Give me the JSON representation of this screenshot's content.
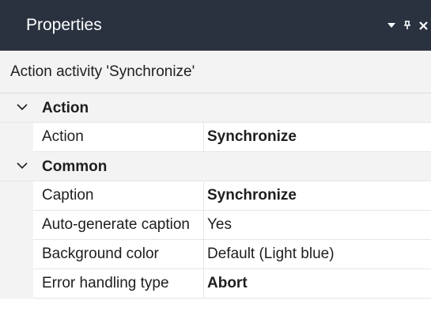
{
  "panel": {
    "title": "Properties",
    "colors": {
      "titlebar": "#2a3240",
      "title_text": "#ffffff",
      "category_bg": "#f3f3f3"
    },
    "buttons": {
      "dropdown_icon": "caret-down-icon",
      "pin_icon": "pin-icon",
      "pin_glyph": "ԉ",
      "close_icon": "close-icon",
      "close_glyph": "×"
    }
  },
  "context_label": "Action activity 'Synchronize'",
  "categories": [
    {
      "label": "Action",
      "expanded": true,
      "rows": [
        {
          "name": "Action",
          "value": "Synchronize",
          "bold": true
        }
      ]
    },
    {
      "label": "Common",
      "expanded": true,
      "rows": [
        {
          "name": "Caption",
          "value": "Synchronize",
          "bold": true
        },
        {
          "name": "Auto-generate caption",
          "value": "Yes",
          "bold": false
        },
        {
          "name": "Background color",
          "value": "Default (Light blue)",
          "bold": false
        },
        {
          "name": "Error handling type",
          "value": "Abort",
          "bold": true
        }
      ]
    }
  ]
}
